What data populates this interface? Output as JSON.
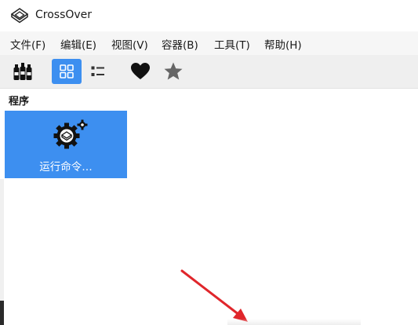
{
  "window": {
    "title": "CrossOver"
  },
  "menu": [
    {
      "label": "文件(F)"
    },
    {
      "label": "编辑(E)"
    },
    {
      "label": "视图(V)"
    },
    {
      "label": "容器(B)"
    },
    {
      "label": "工具(T)"
    },
    {
      "label": "帮助(H)"
    }
  ],
  "toolbar": {
    "buttons": [
      {
        "icon": "bottles-icon",
        "active": false
      },
      {
        "icon": "grid-view-icon",
        "active": true
      },
      {
        "icon": "list-view-icon",
        "active": false
      },
      {
        "icon": "heart-icon",
        "active": false
      },
      {
        "icon": "star-icon",
        "active": false
      }
    ]
  },
  "section": {
    "label": "程序"
  },
  "programs": [
    {
      "label": "运行命令…",
      "icon": "run-command-gear-icon",
      "selected": true
    }
  ],
  "colors": {
    "accent": "#3d8ff0",
    "menubar_bg": "#f6f6f6",
    "toolbar_bg": "#efefef",
    "annotation_arrow": "#e0262b"
  }
}
